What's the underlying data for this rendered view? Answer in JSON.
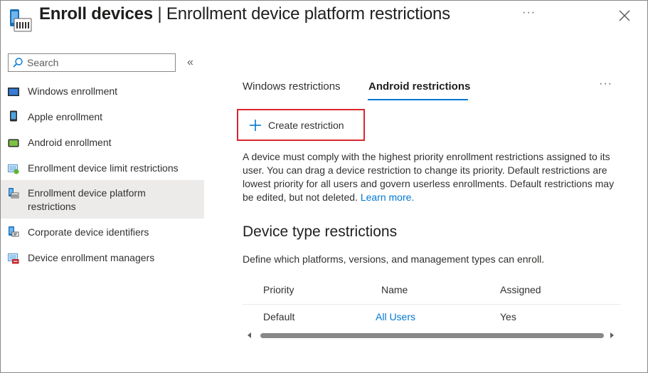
{
  "header": {
    "title_bold": "Enroll devices",
    "title_rest": " | Enrollment device platform restrictions",
    "more": "···",
    "icon": "device-enrollment-icon",
    "close_icon": "close-icon"
  },
  "sidebar": {
    "search_placeholder": "Search",
    "collapse_label": "«",
    "items": [
      {
        "label": "Windows enrollment",
        "icon": "windows-device-icon"
      },
      {
        "label": "Apple enrollment",
        "icon": "apple-device-icon"
      },
      {
        "label": "Android enrollment",
        "icon": "android-device-icon"
      },
      {
        "label": "Enrollment device limit restrictions",
        "icon": "device-limit-icon"
      },
      {
        "label_line1": "Enrollment device platform",
        "label_line2": "restrictions",
        "icon": "platform-restrictions-icon",
        "active": true
      },
      {
        "label": "Corporate device identifiers",
        "icon": "corporate-identifiers-icon"
      },
      {
        "label": "Device enrollment managers",
        "icon": "enrollment-managers-icon"
      }
    ]
  },
  "tabs": {
    "items": [
      {
        "label": "Windows restrictions"
      },
      {
        "label": "Android restrictions",
        "active": true
      }
    ],
    "more": "···"
  },
  "toolbar": {
    "create_label": "Create restriction"
  },
  "description": {
    "text": "A device must comply with the highest priority enrollment restrictions assigned to its user. You can drag a device restriction to change its priority. Default restrictions are lowest priority for all users and govern userless enrollments. Default restrictions may be edited, but not deleted.",
    "link": "Learn more."
  },
  "section": {
    "title": "Device type restrictions",
    "subtitle": "Define which platforms, versions, and management types can enroll."
  },
  "table": {
    "columns": [
      "Priority",
      "Name",
      "Assigned"
    ],
    "rows": [
      {
        "priority": "Default",
        "name": "All Users",
        "assigned": "Yes"
      }
    ]
  },
  "colors": {
    "accent": "#0078d4",
    "highlight_border": "#d9272e",
    "active_nav_bg": "#edebe9"
  }
}
